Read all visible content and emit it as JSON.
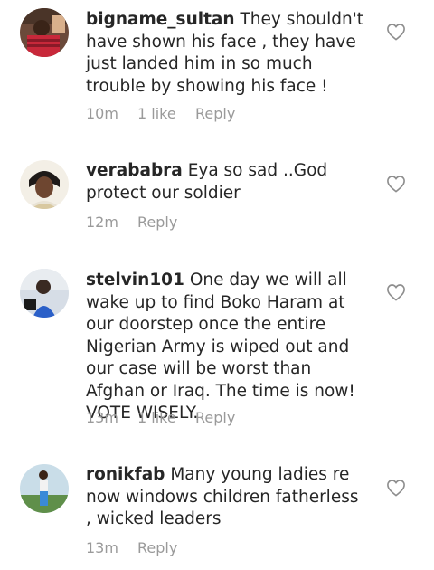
{
  "comments": [
    {
      "username": "bigname_sultan",
      "text": "They shouldn't have shown his face , they have just landed him in so much trouble by showing his face !",
      "time": "10m",
      "likes": "1 like",
      "reply_label": "Reply"
    },
    {
      "username": "verababra",
      "text": "Eya so sad ..God protect our soldier",
      "time": "12m",
      "likes": "",
      "reply_label": "Reply"
    },
    {
      "username": "stelvin101",
      "text": "One day we will all wake up to find Boko Haram at our doorstep once the entire Nigerian Army is wiped out and our case will be worst than Afghan or Iraq. The time is now! VOTE WISELY.",
      "time": "13m",
      "likes": "1 like",
      "reply_label": "Reply"
    },
    {
      "username": "ronikfab",
      "text": "Many young ladies re now windows children fatherless , wicked leaders",
      "time": "13m",
      "likes": "",
      "reply_label": "Reply"
    }
  ],
  "icons": {
    "like": "heart-outline-icon"
  },
  "colors": {
    "meta": "#9a9a9a",
    "heart": "#8e8e8e"
  }
}
